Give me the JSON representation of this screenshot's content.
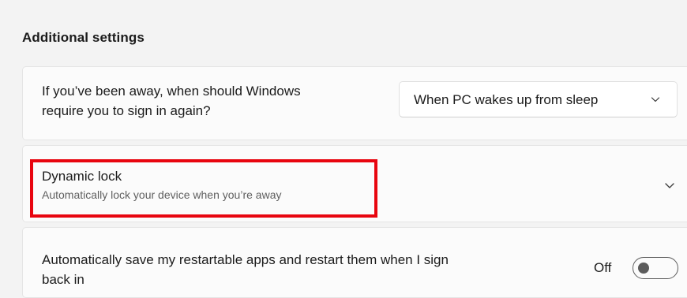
{
  "additional_settings": {
    "heading": "Additional settings"
  },
  "signin_required": {
    "description_line1": "If you’ve been away, when should Windows",
    "description_line2": "require you to sign in again?",
    "dropdown_value": "When PC wakes up from sleep",
    "dropdown_icon": "chevron-down-icon"
  },
  "dynamic_lock": {
    "title": "Dynamic lock",
    "subtitle": "Automatically lock your device when you’re away",
    "expand_icon": "chevron-down-icon",
    "highlight_color": "#e8050f"
  },
  "restart_apps": {
    "description_line1": "Automatically save my restartable apps and restart them when I sign",
    "description_line2": "back in",
    "toggle_state_label": "Off",
    "toggle_on": false
  }
}
